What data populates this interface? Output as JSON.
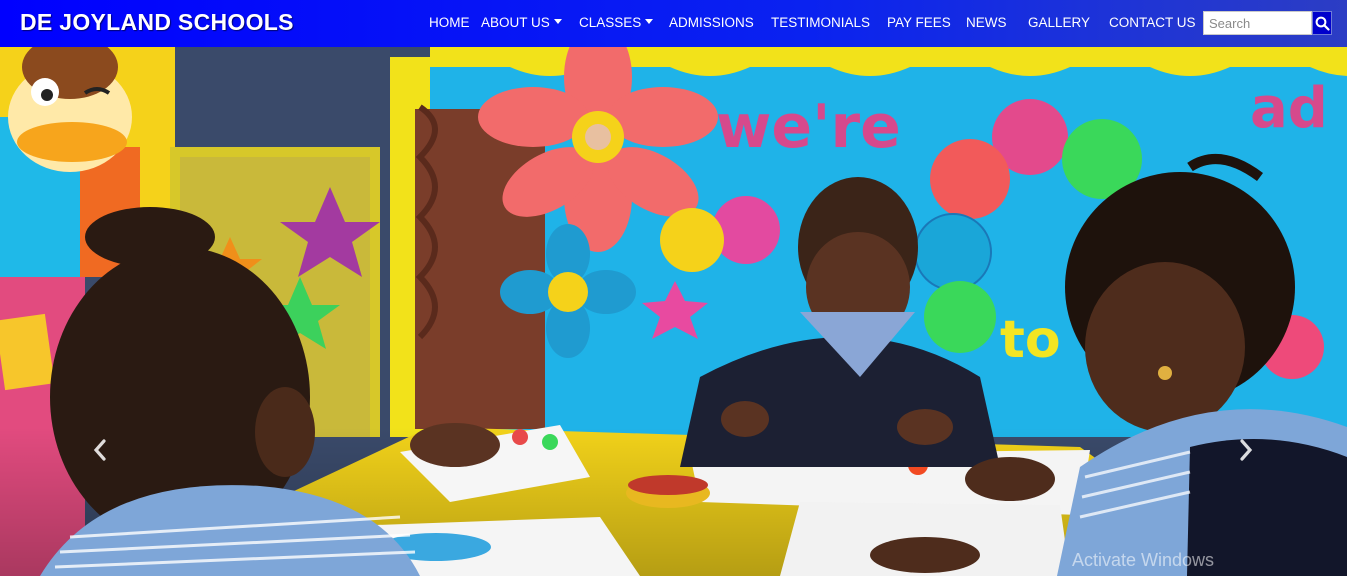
{
  "brand": "DE JOYLAND SCHOOLS",
  "nav": {
    "items": [
      {
        "label": "HOME"
      },
      {
        "label": "ABOUT US",
        "dropdown": true
      },
      {
        "label": "CLASSES",
        "dropdown": true
      },
      {
        "label": "ADMISSIONS"
      },
      {
        "label": "TESTIMONIALS"
      },
      {
        "label": "PAY FEES"
      },
      {
        "label": "NEWS"
      },
      {
        "label": "GALLERY"
      },
      {
        "label": "CONTACT US"
      }
    ]
  },
  "search": {
    "placeholder": "Search",
    "icon": "search-icon"
  },
  "carousel": {
    "prev_icon": "chevron-left-icon",
    "next_icon": "chevron-right-icon"
  },
  "watermark": "Activate Windows",
  "colors": {
    "navbar": "#0000ff",
    "wall_blue": "#1eb4e6",
    "table_yellow": "#f2d21a",
    "uniform_stripes": "#7ea6d8",
    "poster_yellow": "#f5e600"
  }
}
